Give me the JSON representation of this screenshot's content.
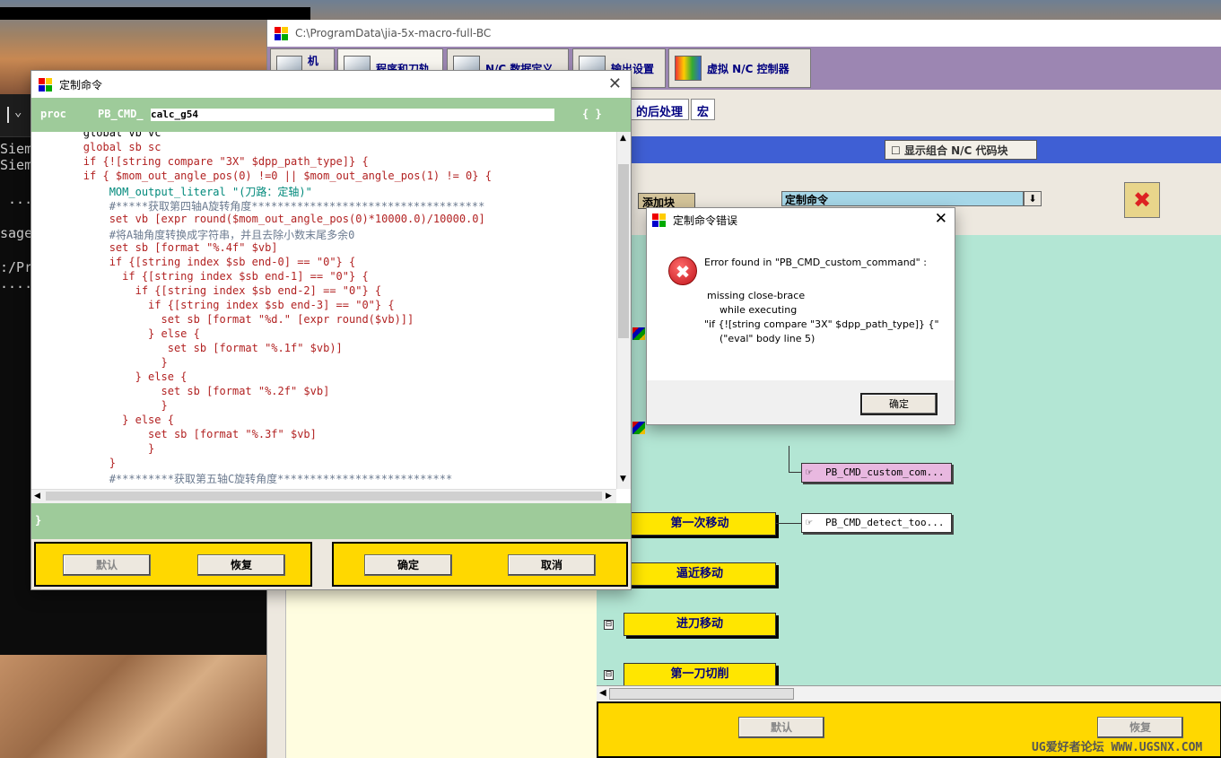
{
  "terminal": {
    "lines": [
      "Siem",
      "Siem",
      " ...",
      "sage",
      ":/Pr",
      "...."
    ]
  },
  "main_window": {
    "title": "C:\\ProgramData\\jia-5x-macro-full-BC",
    "tabs": [
      "机床",
      "程序和刀轨",
      "N/C 数据定义",
      "输出设置",
      "虚拟 N/C 控制器"
    ],
    "subtabs": [
      "的后处理",
      "宏"
    ],
    "show_combined_label": "显示组合 N/C 代码块",
    "checkbox_glyph": "☐",
    "add_block_label": "添加块",
    "dropdown_value": "定制命令",
    "dropdown_arrow": "⬇",
    "trash_glyph": "✖",
    "events": [
      "第一次移动",
      "逼近移动",
      "进刀移动",
      "第一刀切削"
    ],
    "expander_glyph": "⊟",
    "hand_glyph": "☞",
    "commands": [
      "PB_CMD_custom_com...",
      "PB_CMD_detect_too..."
    ],
    "buttons": {
      "default": "默认",
      "restore": "恢复"
    }
  },
  "editor": {
    "title": "定制命令",
    "close_glyph": "✕",
    "proc_keyword": "proc",
    "proc_prefix": "PB_CMD_",
    "proc_name": "calc_g54",
    "brace_open": "{ }",
    "brace_close": "}",
    "code_lines": [
      {
        "kind": "tx",
        "text": "        global vb vc"
      },
      {
        "kind": "kw",
        "text": "        global sb sc"
      },
      {
        "kind": "kw",
        "text": "        if {![string compare \"3X\" $dpp_path_type]} {"
      },
      {
        "kind": "kw",
        "text": "        if { $mom_out_angle_pos(0) !=0 || $mom_out_angle_pos(1) != 0} {"
      },
      {
        "kind": "cmd",
        "text": "            MOM_output_literal \"(刀路：定轴)\""
      },
      {
        "kind": "cm",
        "text": "            #*****获取第四轴A旋转角度************************************"
      },
      {
        "kind": "kw",
        "text": "            set vb [expr round($mom_out_angle_pos(0)*10000.0)/10000.0]"
      },
      {
        "kind": "cm",
        "text": "            #将A轴角度转换成字符串，并且去除小数末尾多余0"
      },
      {
        "kind": "kw",
        "text": "            set sb [format \"%.4f\" $vb]"
      },
      {
        "kind": "kw",
        "text": "            if {[string index $sb end-0] == \"0\"} {"
      },
      {
        "kind": "kw",
        "text": "              if {[string index $sb end-1] == \"0\"} {"
      },
      {
        "kind": "kw",
        "text": "                if {[string index $sb end-2] == \"0\"} {"
      },
      {
        "kind": "kw",
        "text": "                  if {[string index $sb end-3] == \"0\"} {"
      },
      {
        "kind": "kw",
        "text": "                    set sb [format \"%d.\" [expr round($vb)]]"
      },
      {
        "kind": "kw",
        "text": "                  } else {"
      },
      {
        "kind": "kw",
        "text": "                     set sb [format \"%.1f\" $vb)]"
      },
      {
        "kind": "kw",
        "text": "                    }"
      },
      {
        "kind": "kw",
        "text": "                } else {"
      },
      {
        "kind": "kw",
        "text": "                    set sb [format \"%.2f\" $vb]"
      },
      {
        "kind": "kw",
        "text": "                    }"
      },
      {
        "kind": "kw",
        "text": "              } else {"
      },
      {
        "kind": "kw",
        "text": "                  set sb [format \"%.3f\" $vb]"
      },
      {
        "kind": "kw",
        "text": "                  }"
      },
      {
        "kind": "kw",
        "text": "            }"
      },
      {
        "kind": "cm",
        "text": "            #*********获取第五轴C旋转角度***************************"
      }
    ],
    "buttons": {
      "default": "默认",
      "restore": "恢复",
      "ok": "确定",
      "cancel": "取消"
    }
  },
  "error_dialog": {
    "title": "定制命令错误",
    "close_glyph": "✕",
    "icon_glyph": "✖",
    "lines": [
      "Error found in \"PB_CMD_custom_command\" :",
      "missing close-brace",
      "    while executing",
      "\"if {![string compare \"3X\" $dpp_path_type]} {\"",
      "    (\"eval\" body line 5)"
    ],
    "ok_label": "确定"
  },
  "watermark": "UG爱好者论坛 WWW.UGSNX.COM"
}
